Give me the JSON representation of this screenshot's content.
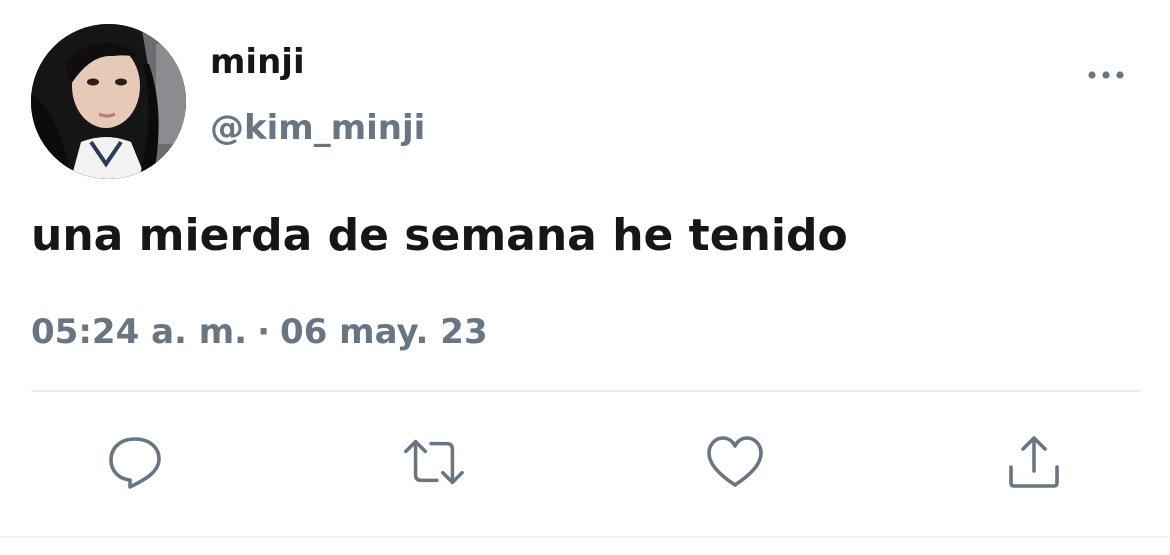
{
  "user": {
    "display_name": "minji",
    "handle": "@kim_minji",
    "avatar_icon": "profile-photo"
  },
  "tweet": {
    "text": "una mierda de semana he tenido",
    "time": "05:24 a. m.",
    "separator": "·",
    "date": "06 may. 23"
  },
  "actions": {
    "more_icon": "more-options-icon",
    "reply_icon": "reply-icon",
    "retweet_icon": "retweet-icon",
    "like_icon": "like-icon",
    "share_icon": "share-icon"
  },
  "colors": {
    "text_primary": "#14171a",
    "text_secondary": "#687684",
    "divider": "#e8ebee"
  }
}
